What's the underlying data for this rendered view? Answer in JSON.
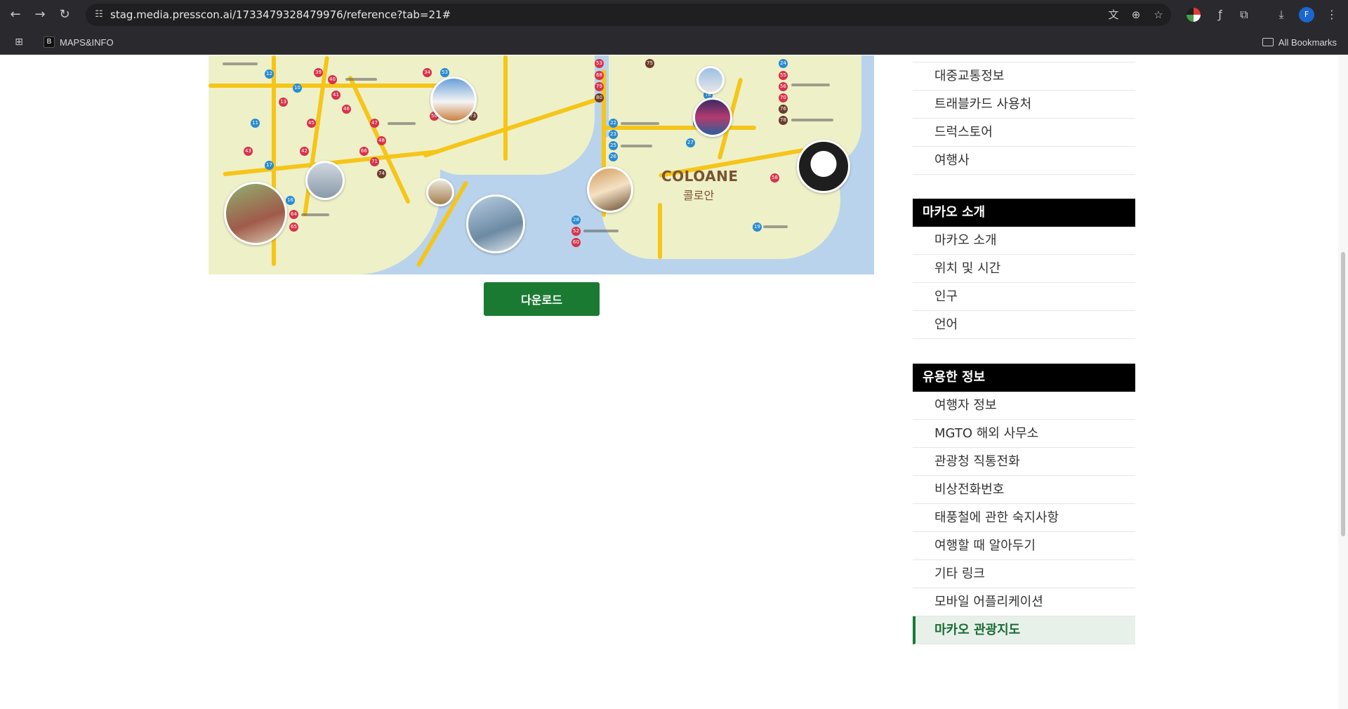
{
  "browser": {
    "url": "stag.media.presscon.ai/1733479328479976/reference?tab=21#",
    "bookmark_label": "MAPS&INFO",
    "bookmark_favicon_letter": "B",
    "all_bookmarks_label": "All Bookmarks",
    "profile_initial": "F"
  },
  "map": {
    "region_title": "COLOANE",
    "region_subtitle": "콜로안"
  },
  "download_label": "다운로드",
  "sidebar": {
    "group_top": {
      "items": [
        "대중교통정보",
        "트래블카드 사용처",
        "드럭스토어",
        "여행사"
      ]
    },
    "group_intro": {
      "header": "마카오 소개",
      "items": [
        "마카오 소개",
        "위치 및 시간",
        "인구",
        "언어"
      ]
    },
    "group_info": {
      "header": "유용한 정보",
      "items": [
        "여행자 정보",
        "MGTO 해외 사무소",
        "관광청 직통전화",
        "비상전화번호",
        "태풍철에 관한 숙지사항",
        "여행할 때 알아두기",
        "기타 링크",
        "모바일 어플리케이션",
        "마카오 관광지도"
      ],
      "active_index": 8
    }
  },
  "colors": {
    "accent_green": "#1a7a32",
    "active_bg": "#e7f1ea",
    "header_bg": "#000000"
  }
}
